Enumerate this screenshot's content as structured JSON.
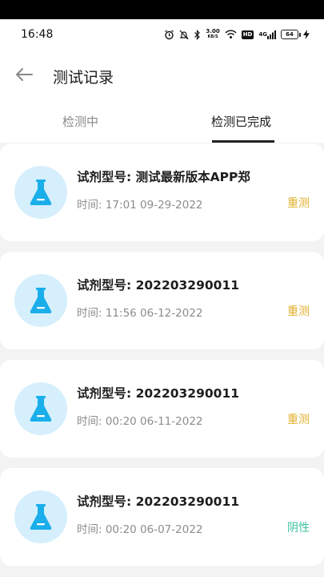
{
  "status_bar": {
    "time": "16:48",
    "net_speed": "3.00",
    "net_unit": "KB/S",
    "hd": "HD",
    "signal": "4G",
    "battery": "64"
  },
  "header": {
    "title": "测试记录"
  },
  "tabs": [
    {
      "label": "检测中",
      "active": false
    },
    {
      "label": "检测已完成",
      "active": true
    }
  ],
  "records": [
    {
      "title": "试剂型号: 测试最新版本APP郑",
      "time": "时间: 17:01 09-29-2022",
      "status": "重测",
      "status_color": "#e1b12c"
    },
    {
      "title": "试剂型号: 202203290011",
      "time": "时间: 11:56 06-12-2022",
      "status": "重测",
      "status_color": "#e1b12c"
    },
    {
      "title": "试剂型号: 202203290011",
      "time": "时间: 00:20 06-11-2022",
      "status": "重测",
      "status_color": "#e1b12c"
    },
    {
      "title": "试剂型号: 202203290011",
      "time": "时间: 00:20 06-07-2022",
      "status": "阴性",
      "status_color": "#3cc2a0"
    }
  ],
  "colors": {
    "accent_blue": "#1aaeea",
    "avatar_bg": "#d6effd"
  }
}
